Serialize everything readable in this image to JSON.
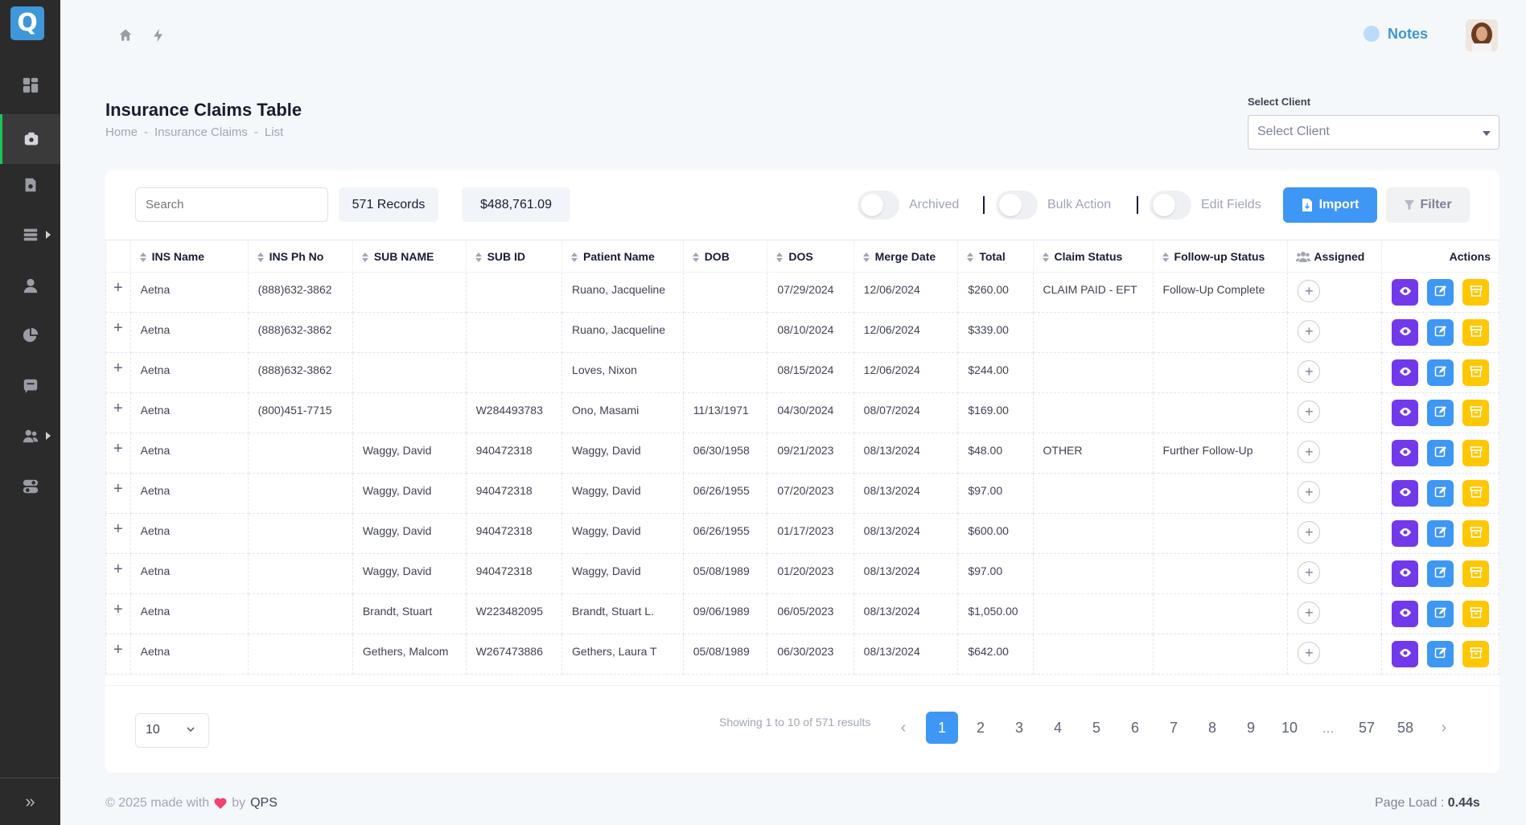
{
  "app": {
    "logo_letter": "Q"
  },
  "header": {
    "notes_label": "Notes"
  },
  "page": {
    "title": "Insurance Claims Table",
    "breadcrumb": [
      "Home",
      "Insurance Claims",
      "List"
    ],
    "breadcrumb_sep": "-"
  },
  "client_select": {
    "label": "Select Client",
    "placeholder": "Select Client"
  },
  "toolbar": {
    "search_placeholder": "Search",
    "records": "571 Records",
    "total_amount": "$488,761.09",
    "archived_label": "Archived",
    "bulk_action_label": "Bulk Action",
    "edit_fields_label": "Edit Fields",
    "import_label": "Import",
    "filter_label": "Filter"
  },
  "table": {
    "headers": [
      "INS Name",
      "INS Ph No",
      "SUB NAME",
      "SUB ID",
      "Patient Name",
      "DOB",
      "DOS",
      "Merge Date",
      "Total",
      "Claim Status",
      "Follow-up Status",
      "Assigned",
      "Actions"
    ],
    "rows": [
      [
        "Aetna",
        "(888)632-3862",
        "",
        "",
        "Ruano, Jacqueline",
        "",
        "07/29/2024",
        "12/06/2024",
        "$260.00",
        "CLAIM PAID - EFT",
        "Follow-Up Complete"
      ],
      [
        "Aetna",
        "(888)632-3862",
        "",
        "",
        "Ruano, Jacqueline",
        "",
        "08/10/2024",
        "12/06/2024",
        "$339.00",
        "",
        ""
      ],
      [
        "Aetna",
        "(888)632-3862",
        "",
        "",
        "Loves, Nixon",
        "",
        "08/15/2024",
        "12/06/2024",
        "$244.00",
        "",
        ""
      ],
      [
        "Aetna",
        "(800)451-7715",
        "",
        "W284493783",
        "Ono, Masami",
        "11/13/1971",
        "04/30/2024",
        "08/07/2024",
        "$169.00",
        "",
        ""
      ],
      [
        "Aetna",
        "",
        "Waggy, David",
        "940472318",
        "Waggy, David",
        "06/30/1958",
        "09/21/2023",
        "08/13/2024",
        "$48.00",
        "OTHER",
        "Further Follow-Up"
      ],
      [
        "Aetna",
        "",
        "Waggy, David",
        "940472318",
        "Waggy, David",
        "06/26/1955",
        "07/20/2023",
        "08/13/2024",
        "$97.00",
        "",
        ""
      ],
      [
        "Aetna",
        "",
        "Waggy, David",
        "940472318",
        "Waggy, David",
        "06/26/1955",
        "01/17/2023",
        "08/13/2024",
        "$600.00",
        "",
        ""
      ],
      [
        "Aetna",
        "",
        "Waggy, David",
        "940472318",
        "Waggy, David",
        "05/08/1989",
        "01/20/2023",
        "08/13/2024",
        "$97.00",
        "",
        ""
      ],
      [
        "Aetna",
        "",
        "Brandt, Stuart",
        "W223482095",
        "Brandt, Stuart L.",
        "09/06/1989",
        "06/05/2023",
        "08/13/2024",
        "$1,050.00",
        "",
        ""
      ],
      [
        "Aetna",
        "",
        "Gethers, Malcom",
        "W267473886",
        "Gethers, Laura T",
        "05/08/1989",
        "06/30/2023",
        "08/13/2024",
        "$642.00",
        "",
        ""
      ]
    ]
  },
  "pagination": {
    "per_page": "10",
    "showing": "Showing 1 to 10 of 571 results",
    "prev": "‹",
    "next": "›",
    "pages": [
      "1",
      "2",
      "3",
      "4",
      "5",
      "6",
      "7",
      "8",
      "9",
      "10",
      "...",
      "57",
      "58"
    ],
    "active_page": "1"
  },
  "footer": {
    "made_with": "© 2025 made with",
    "by": "by",
    "brand": "QPS",
    "page_load_label": "Page Load :",
    "page_load_value": "0.44s"
  },
  "icons": {
    "sidebar": [
      "dashboard-icon",
      "claims-icon",
      "billing-icon",
      "list-icon",
      "user-icon",
      "pie-chart-icon",
      "message-icon",
      "users-icon",
      "toggle-icon"
    ],
    "expand_sidebar": "double-chevron-right-icon"
  },
  "colors": {
    "accent": "#3e97f5",
    "view": "#7239ea",
    "archive": "#ffc700",
    "active_indicator": "#1bc55a"
  }
}
